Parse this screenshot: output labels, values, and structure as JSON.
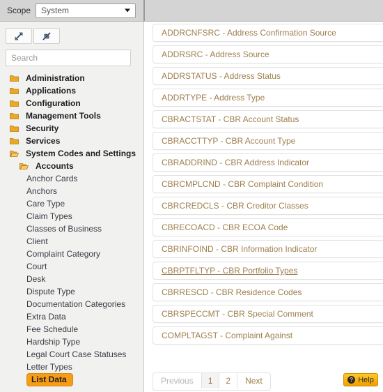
{
  "scope": {
    "label": "Scope",
    "value": "System",
    "caret_icon": "chevron-down-icon"
  },
  "tree_panel": {
    "expand_all_icon": "expand-arrows-icon",
    "collapse_all_icon": "collapse-arrows-icon",
    "search_placeholder": "Search",
    "search_value": "",
    "items": [
      {
        "label": "Administration",
        "level": 0,
        "icon": "folder-closed-icon",
        "bold": true,
        "selected": false
      },
      {
        "label": "Applications",
        "level": 0,
        "icon": "folder-closed-icon",
        "bold": true,
        "selected": false
      },
      {
        "label": "Configuration",
        "level": 0,
        "icon": "folder-closed-icon",
        "bold": true,
        "selected": false
      },
      {
        "label": "Management Tools",
        "level": 0,
        "icon": "folder-closed-icon",
        "bold": true,
        "selected": false
      },
      {
        "label": "Security",
        "level": 0,
        "icon": "folder-closed-icon",
        "bold": true,
        "selected": false
      },
      {
        "label": "Services",
        "level": 0,
        "icon": "folder-closed-icon",
        "bold": true,
        "selected": false
      },
      {
        "label": "System Codes and Settings",
        "level": 0,
        "icon": "folder-open-icon",
        "bold": true,
        "selected": false
      },
      {
        "label": "Accounts",
        "level": 1,
        "icon": "folder-open-icon",
        "bold": true,
        "selected": false
      },
      {
        "label": "Anchor Cards",
        "level": 2,
        "icon": "none",
        "bold": false,
        "selected": false
      },
      {
        "label": "Anchors",
        "level": 2,
        "icon": "none",
        "bold": false,
        "selected": false
      },
      {
        "label": "Care Type",
        "level": 2,
        "icon": "none",
        "bold": false,
        "selected": false
      },
      {
        "label": "Claim Types",
        "level": 2,
        "icon": "none",
        "bold": false,
        "selected": false
      },
      {
        "label": "Classes of Business",
        "level": 2,
        "icon": "none",
        "bold": false,
        "selected": false
      },
      {
        "label": "Client",
        "level": 2,
        "icon": "none",
        "bold": false,
        "selected": false
      },
      {
        "label": "Complaint Category",
        "level": 2,
        "icon": "none",
        "bold": false,
        "selected": false
      },
      {
        "label": "Court",
        "level": 2,
        "icon": "none",
        "bold": false,
        "selected": false
      },
      {
        "label": "Desk",
        "level": 2,
        "icon": "none",
        "bold": false,
        "selected": false
      },
      {
        "label": "Dispute Type",
        "level": 2,
        "icon": "none",
        "bold": false,
        "selected": false
      },
      {
        "label": "Documentation Categories",
        "level": 2,
        "icon": "none",
        "bold": false,
        "selected": false
      },
      {
        "label": "Extra Data",
        "level": 2,
        "icon": "none",
        "bold": false,
        "selected": false
      },
      {
        "label": "Fee Schedule",
        "level": 2,
        "icon": "none",
        "bold": false,
        "selected": false
      },
      {
        "label": "Hardship Type",
        "level": 2,
        "icon": "none",
        "bold": false,
        "selected": false
      },
      {
        "label": "Legal Court Case Statuses",
        "level": 2,
        "icon": "none",
        "bold": false,
        "selected": false
      },
      {
        "label": "Letter Types",
        "level": 2,
        "icon": "none",
        "bold": false,
        "selected": false
      },
      {
        "label": "List Data",
        "level": 2,
        "icon": "none",
        "bold": true,
        "selected": true
      }
    ]
  },
  "content": {
    "code_items": [
      {
        "label": "ADDRCNFSRC - Address Confirmation Source",
        "hovered": false
      },
      {
        "label": "ADDRSRC - Address Source",
        "hovered": false
      },
      {
        "label": "ADDRSTATUS - Address Status",
        "hovered": false
      },
      {
        "label": "ADDRTYPE - Address Type",
        "hovered": false
      },
      {
        "label": "CBRACTSTAT - CBR Account Status",
        "hovered": false
      },
      {
        "label": "CBRACCTTYP - CBR Account Type",
        "hovered": false
      },
      {
        "label": "CBRADDRIND - CBR Address Indicator",
        "hovered": false
      },
      {
        "label": "CBRCMPLCND - CBR Complaint Condition",
        "hovered": false
      },
      {
        "label": "CBRCREDCLS - CBR Creditor Classes",
        "hovered": false
      },
      {
        "label": "CBRECOACD - CBR ECOA Code",
        "hovered": false
      },
      {
        "label": "CBRINFOIND - CBR Information Indicator",
        "hovered": false
      },
      {
        "label": "CBRPTFLTYP - CBR Portfolio Types",
        "hovered": true
      },
      {
        "label": "CBRRESCD - CBR Residence Codes",
        "hovered": false
      },
      {
        "label": "CBRSPECCMT - CBR Special Comment",
        "hovered": false
      },
      {
        "label": "COMPLTAGST - Complaint Against",
        "hovered": false
      }
    ],
    "pagination": [
      {
        "label": "Previous",
        "state": "disabled"
      },
      {
        "label": "1",
        "state": "active"
      },
      {
        "label": "2",
        "state": "link"
      },
      {
        "label": "Next",
        "state": "link"
      }
    ]
  },
  "help": {
    "label": "Help",
    "icon": "question-mark-icon",
    "glyph": "?"
  },
  "colors": {
    "accent_orange": "#f79c16",
    "link_gold": "#9d7f4e",
    "help_gold": "#f0a000",
    "folder_gold": "#e8a427"
  }
}
